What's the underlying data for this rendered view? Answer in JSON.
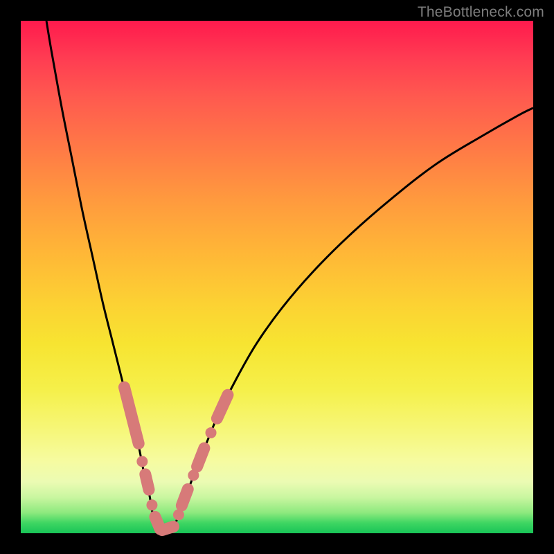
{
  "watermark": "TheBottleneck.com",
  "colors": {
    "curve_stroke": "#000000",
    "marker_fill": "#d77a79",
    "marker_stroke": "#d77a79"
  },
  "chart_data": {
    "type": "line",
    "title": "",
    "xlabel": "",
    "ylabel": "",
    "xlim": [
      0,
      100
    ],
    "ylim": [
      0,
      100
    ],
    "grid": false,
    "legend": false,
    "series": [
      {
        "name": "bottleneck-curve-left",
        "x": [
          5.0,
          6.0,
          8.0,
          10.0,
          12.0,
          14.0,
          16.0,
          18.0,
          20.0,
          21.5,
          23.0,
          24.0,
          25.0,
          25.7,
          26.3
        ],
        "values": [
          100,
          94,
          83,
          73,
          63,
          54,
          45,
          37,
          29,
          23,
          17,
          12,
          8,
          4,
          1.5
        ]
      },
      {
        "name": "bottleneck-curve-bottom",
        "x": [
          26.3,
          27.0,
          28.0,
          29.0,
          30.0
        ],
        "values": [
          1.5,
          0.8,
          0.5,
          0.8,
          1.5
        ]
      },
      {
        "name": "bottleneck-curve-right",
        "x": [
          30.0,
          31.0,
          32.5,
          34.0,
          36.0,
          38.5,
          42.0,
          46.0,
          51.0,
          57.0,
          64.0,
          72.0,
          81.0,
          90.0,
          97.0,
          100.0
        ],
        "values": [
          1.5,
          4,
          8,
          12,
          17,
          23,
          30,
          37,
          44,
          51,
          58,
          65,
          72,
          77.5,
          81.5,
          83
        ]
      }
    ],
    "markers": [
      {
        "shape": "capsule",
        "x1": 20.2,
        "y1": 28.5,
        "x2": 23.0,
        "y2": 17.5
      },
      {
        "shape": "dot",
        "x": 23.7,
        "y": 14.0
      },
      {
        "shape": "capsule",
        "x1": 24.3,
        "y1": 11.5,
        "x2": 25.0,
        "y2": 8.5
      },
      {
        "shape": "dot",
        "x": 25.6,
        "y": 5.5
      },
      {
        "shape": "capsule",
        "x1": 26.2,
        "y1": 3.2,
        "x2": 27.2,
        "y2": 0.8
      },
      {
        "shape": "capsule",
        "x1": 27.6,
        "y1": 0.6,
        "x2": 29.8,
        "y2": 1.3
      },
      {
        "shape": "dot",
        "x": 30.8,
        "y": 3.6
      },
      {
        "shape": "capsule",
        "x1": 31.4,
        "y1": 5.4,
        "x2": 32.6,
        "y2": 8.6
      },
      {
        "shape": "dot",
        "x": 33.7,
        "y": 11.3
      },
      {
        "shape": "capsule",
        "x1": 34.4,
        "y1": 13.0,
        "x2": 35.8,
        "y2": 16.6
      },
      {
        "shape": "dot",
        "x": 37.1,
        "y": 19.6
      },
      {
        "shape": "capsule",
        "x1": 38.3,
        "y1": 22.4,
        "x2": 40.4,
        "y2": 27.0
      }
    ]
  }
}
